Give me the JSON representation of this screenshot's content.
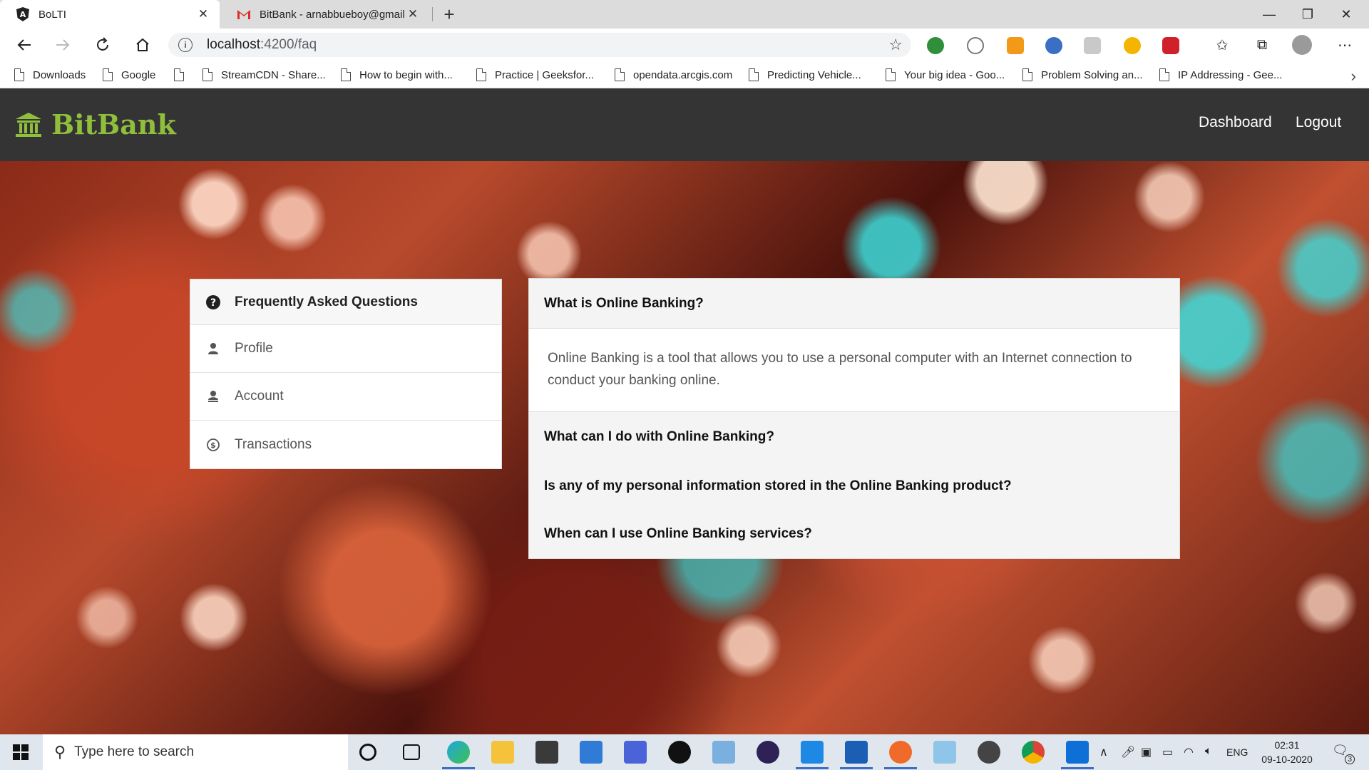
{
  "browser": {
    "tabs": [
      {
        "title": "BoLTI",
        "active": true
      },
      {
        "title": "BitBank - arnabbueboy@gmail.c",
        "active": false
      }
    ],
    "url": {
      "host": "localhost",
      "rest": ":4200/faq"
    },
    "bookmarks": [
      "Downloads",
      "Google",
      "",
      "StreamCDN - Share...",
      "How to begin with...",
      "Practice | Geeksfor...",
      "opendata.arcgis.com",
      "Predicting Vehicle...",
      "Your big idea - Goo...",
      "Problem Solving an...",
      "IP Addressing - Gee..."
    ]
  },
  "header": {
    "brand": "BitBank",
    "nav": {
      "dashboard": "Dashboard",
      "logout": "Logout"
    },
    "brand_color": "#8fbf3b"
  },
  "faq_menu": {
    "title": "Frequently Asked Questions",
    "items": [
      {
        "label": "Profile",
        "icon": "user-icon"
      },
      {
        "label": "Account",
        "icon": "account-icon"
      },
      {
        "label": "Transactions",
        "icon": "dollar-circle-icon"
      }
    ]
  },
  "faq": {
    "items": [
      {
        "question": "What is Online Banking?",
        "answer": "Online Banking is a tool that allows you to use a personal computer with an Internet connection to conduct your banking online.",
        "expanded": true
      },
      {
        "question": "What can I do with Online Banking?",
        "expanded": false
      },
      {
        "question": "Is any of my personal information stored in the Online Banking product?",
        "expanded": false
      },
      {
        "question": "When can I use Online Banking services?",
        "expanded": false
      }
    ]
  },
  "taskbar": {
    "search_placeholder": "Type here to search",
    "language": "ENG",
    "time": "02:31",
    "date": "09-10-2020",
    "notifications": "3"
  }
}
